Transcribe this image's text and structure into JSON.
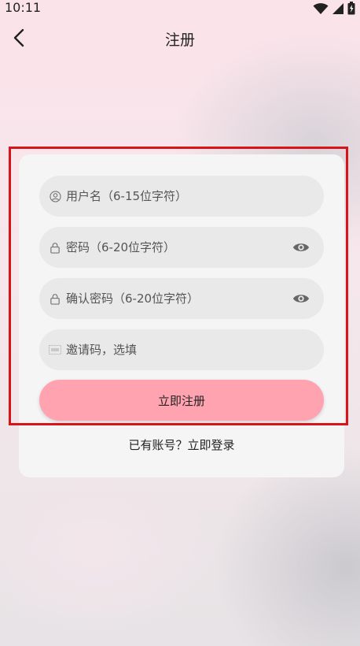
{
  "status_bar": {
    "time": "10:11"
  },
  "header": {
    "title": "注册"
  },
  "form": {
    "username_placeholder": "用户名（6-15位字符）",
    "password_placeholder": "密码（6-20位字符）",
    "confirm_password_placeholder": "确认密码（6-20位字符）",
    "invite_placeholder": "邀请码，选填",
    "submit_label": "立即注册",
    "login_link": "已有账号？立即登录"
  },
  "colors": {
    "accent": "#ffa3b1",
    "highlight": "#d7141a",
    "field_bg": "#e9e9e9"
  }
}
